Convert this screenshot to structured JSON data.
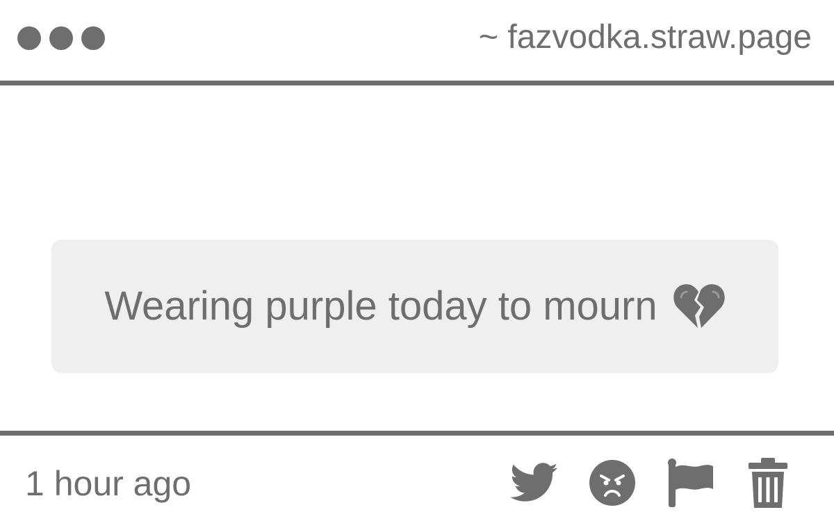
{
  "header": {
    "url": "~ fazvodka.straw.page"
  },
  "message": {
    "text": "Wearing purple today to mourn",
    "emoji_icon": "broken-heart-icon"
  },
  "footer": {
    "timestamp": "1 hour ago",
    "actions": [
      {
        "name": "twitter-share",
        "icon": "twitter-bird-icon"
      },
      {
        "name": "angry-react",
        "icon": "angry-face-icon"
      },
      {
        "name": "report",
        "icon": "flag-icon"
      },
      {
        "name": "delete",
        "icon": "trash-icon"
      }
    ]
  },
  "colors": {
    "foreground": "#6e6e6e",
    "message_background": "#efefef",
    "page_background": "#ffffff"
  }
}
